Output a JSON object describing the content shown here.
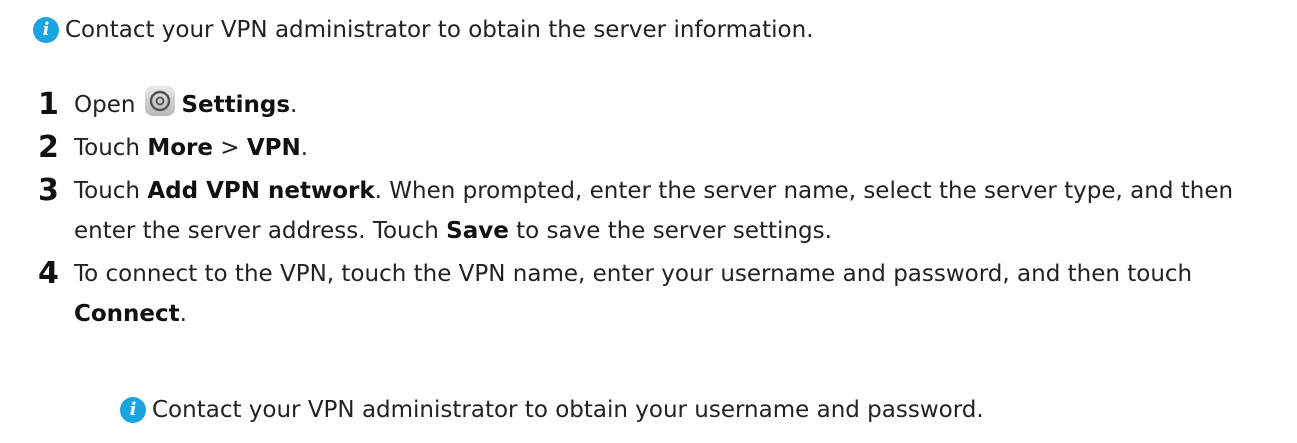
{
  "note_top": {
    "icon": "info-icon",
    "text": "Contact your VPN administrator to obtain the server information."
  },
  "steps": [
    {
      "number": "1",
      "prefix": "Open",
      "icon": "settings-icon",
      "bold": "Settings",
      "suffix": "."
    },
    {
      "number": "2",
      "prefix": "Touch ",
      "bold1": "More",
      "mid": " > ",
      "bold2": "VPN",
      "suffix": "."
    },
    {
      "number": "3",
      "prefix": "Touch ",
      "bold1": "Add VPN network",
      "mid": ". When prompted, enter the server name, select the server type, and then enter the server address. Touch ",
      "bold2": "Save",
      "suffix": " to save the server settings."
    },
    {
      "number": "4",
      "prefix": "To connect to the VPN, touch the VPN name, enter your username and password, and then touch ",
      "bold": "Connect",
      "suffix": "."
    }
  ],
  "note_bottom": {
    "icon": "info-icon",
    "text": "Contact your VPN administrator to obtain your username and password."
  },
  "colors": {
    "info_icon": "#1aa4e0",
    "text": "#222222"
  }
}
